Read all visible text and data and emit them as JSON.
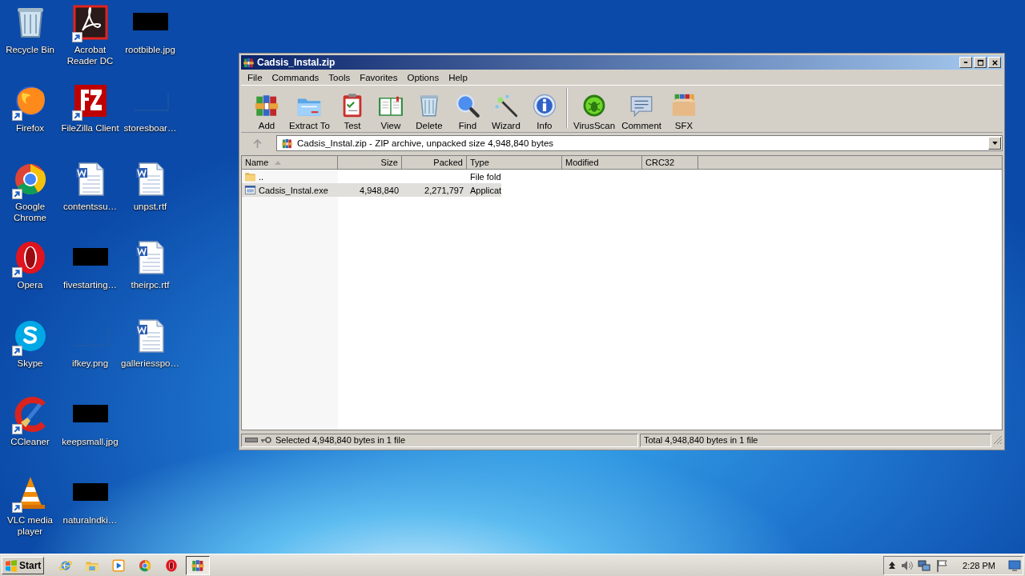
{
  "desktop_icons": [
    {
      "label": "Recycle Bin",
      "kind": "trash",
      "shortcut": false
    },
    {
      "label": "Firefox",
      "kind": "firefox",
      "shortcut": true
    },
    {
      "label": "Google Chrome",
      "kind": "chrome",
      "shortcut": true
    },
    {
      "label": "Opera",
      "kind": "opera",
      "shortcut": true
    },
    {
      "label": "Skype",
      "kind": "skype",
      "shortcut": true
    },
    {
      "label": "CCleaner",
      "kind": "ccleaner",
      "shortcut": true
    },
    {
      "label": "VLC media player",
      "kind": "vlc",
      "shortcut": true
    },
    {
      "label": "Acrobat Reader DC",
      "kind": "acrobat",
      "shortcut": true
    },
    {
      "label": "FileZilla Client",
      "kind": "filezilla",
      "shortcut": true
    },
    {
      "label": "contentssu…",
      "kind": "word",
      "shortcut": false
    },
    {
      "label": "fivestarting…",
      "kind": "black",
      "shortcut": false
    },
    {
      "label": "ifkey.png",
      "kind": "blank",
      "shortcut": false
    },
    {
      "label": "keepsmall.jpg",
      "kind": "black",
      "shortcut": false
    },
    {
      "label": "naturalndki…",
      "kind": "black",
      "shortcut": false
    },
    {
      "label": "rootbible.jpg",
      "kind": "black",
      "shortcut": false
    },
    {
      "label": "storesboar…",
      "kind": "blank",
      "shortcut": false
    },
    {
      "label": "unpst.rtf",
      "kind": "word",
      "shortcut": false
    },
    {
      "label": "theirpc.rtf",
      "kind": "word",
      "shortcut": false
    },
    {
      "label": "galleriesspo…",
      "kind": "word",
      "shortcut": false
    }
  ],
  "window": {
    "title": "Cadsis_Instal.zip",
    "menu": [
      "File",
      "Commands",
      "Tools",
      "Favorites",
      "Options",
      "Help"
    ],
    "toolbar": [
      {
        "label": "Add",
        "kind": "books"
      },
      {
        "label": "Extract To",
        "kind": "folder"
      },
      {
        "label": "Test",
        "kind": "clipboard"
      },
      {
        "label": "View",
        "kind": "book"
      },
      {
        "label": "Delete",
        "kind": "trash"
      },
      {
        "label": "Find",
        "kind": "magnifier"
      },
      {
        "label": "Wizard",
        "kind": "wand"
      },
      {
        "label": "Info",
        "kind": "info"
      },
      {
        "label": "VirusScan",
        "kind": "bug"
      },
      {
        "label": "Comment",
        "kind": "bubble"
      },
      {
        "label": "SFX",
        "kind": "box"
      }
    ],
    "address": "Cadsis_Instal.zip - ZIP archive, unpacked size 4,948,840 bytes",
    "columns": [
      {
        "label": "Name",
        "sorted": true
      },
      {
        "label": "Size",
        "sorted": false
      },
      {
        "label": "Packed",
        "sorted": false
      },
      {
        "label": "Type",
        "sorted": false
      },
      {
        "label": "Modified",
        "sorted": false
      },
      {
        "label": "CRC32",
        "sorted": false
      }
    ],
    "rows": [
      {
        "kind": "folder",
        "name": "..",
        "size": "",
        "packed": "",
        "type": "File fold",
        "selected": false
      },
      {
        "kind": "exe",
        "name": "Cadsis_Instal.exe",
        "size": "4,948,840",
        "packed": "2,271,797",
        "type": "Applicat",
        "selected": true
      }
    ],
    "status_left": "Selected 4,948,840 bytes in 1 file",
    "status_right": "Total 4,948,840 bytes in 1 file"
  },
  "taskbar": {
    "start": "Start",
    "apps": [
      {
        "kind": "ie",
        "selected": false
      },
      {
        "kind": "explorer",
        "selected": false
      },
      {
        "kind": "media",
        "selected": false
      },
      {
        "kind": "chrome",
        "selected": false
      },
      {
        "kind": "opera",
        "selected": false
      },
      {
        "kind": "books",
        "selected": true
      }
    ],
    "time": "2:28 PM"
  }
}
